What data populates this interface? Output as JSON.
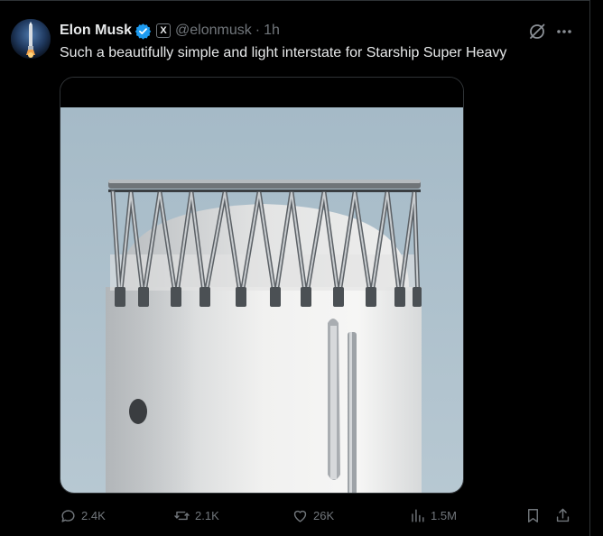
{
  "tweet": {
    "author_name": "Elon Musk",
    "x_badge": "X",
    "handle": "@elonmusk",
    "separator": "·",
    "time": "1h",
    "text": "Such a beautifully simple and light interstate for Starship Super Heavy"
  },
  "actions": {
    "replies": "2.4K",
    "reposts": "2.1K",
    "likes": "26K",
    "views": "1.5M"
  },
  "icons": {
    "verified": "verified-badge-icon",
    "grok": "grok-icon",
    "more": "more-icon",
    "reply": "reply-icon",
    "repost": "repost-icon",
    "like": "like-icon",
    "views": "views-icon",
    "bookmark": "bookmark-icon",
    "share": "share-icon"
  },
  "colors": {
    "background": "#000000",
    "text": "#e7e9ea",
    "secondary_text": "#71767b",
    "verified_blue": "#1d9bf0",
    "border": "#2f3336",
    "sky": "#a9bdc9"
  }
}
